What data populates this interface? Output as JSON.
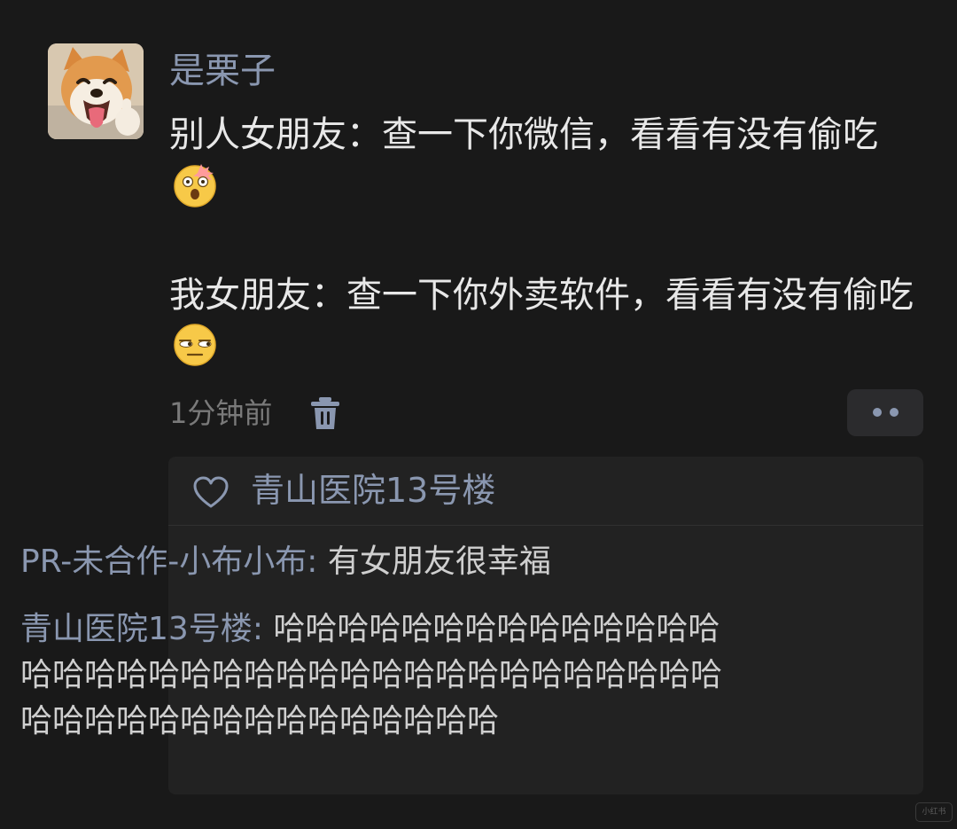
{
  "post": {
    "username": "是栗子",
    "avatar_icon": "shiba-dog-avatar",
    "line1": "别人女朋友：查一下你微信，看看有没有偷吃",
    "emoji1": "face-with-open-mouth-exploding-emoji",
    "line2": "我女朋友：查一下你外卖软件，看看有没有偷吃",
    "emoji2": "unamused-face-emoji",
    "timestamp": "1分钟前",
    "delete_icon": "trash-icon",
    "more_icon": "more-dots-icon"
  },
  "likes": {
    "icon": "heart-icon",
    "names": "青山医院13号楼"
  },
  "comments": [
    {
      "author": "PR-未合作-小布小布",
      "separator": ": ",
      "text": "有女朋友很幸福"
    },
    {
      "author": "青山医院13号楼",
      "separator": ": ",
      "text": "哈哈哈哈哈哈哈哈哈哈哈哈哈哈哈哈哈哈哈哈哈哈哈哈哈哈哈哈哈哈哈哈哈哈哈哈哈哈哈哈哈哈哈哈哈哈哈哈哈哈哈"
    }
  ],
  "watermark": "小红书",
  "colors": {
    "background": "#191919",
    "name_blue": "#8a97b0",
    "text": "#e8e8e8",
    "secondary": "#7a7a7a",
    "panel": "#222222"
  }
}
